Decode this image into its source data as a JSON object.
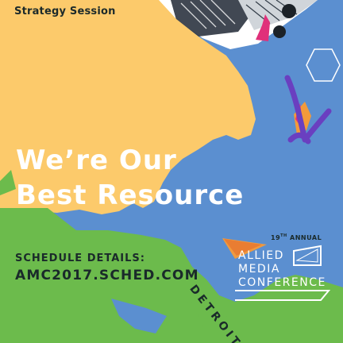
{
  "kicker": "Strategy Session",
  "headline": {
    "line1": "We’re Our",
    "line2": "Best Resource"
  },
  "schedule": {
    "label": "SCHEDULE DETAILS:",
    "url": "AMC2017.SCHED.COM"
  },
  "conference": {
    "annual_number": "19",
    "annual_suffix": "TH",
    "annual_text": "ANNUAL",
    "name_line1": "ALLIED",
    "name_line2": "MEDIA",
    "name_line3": "CONFERENCE",
    "city": "DETROIT"
  },
  "colors": {
    "blue": "#5b8fd0",
    "yellow": "#fcca6b",
    "green": "#6cbb4c",
    "purple": "#6a3fc0",
    "magenta": "#e0307a",
    "orange": "#f39a3a",
    "dark": "#1a2a2a"
  }
}
